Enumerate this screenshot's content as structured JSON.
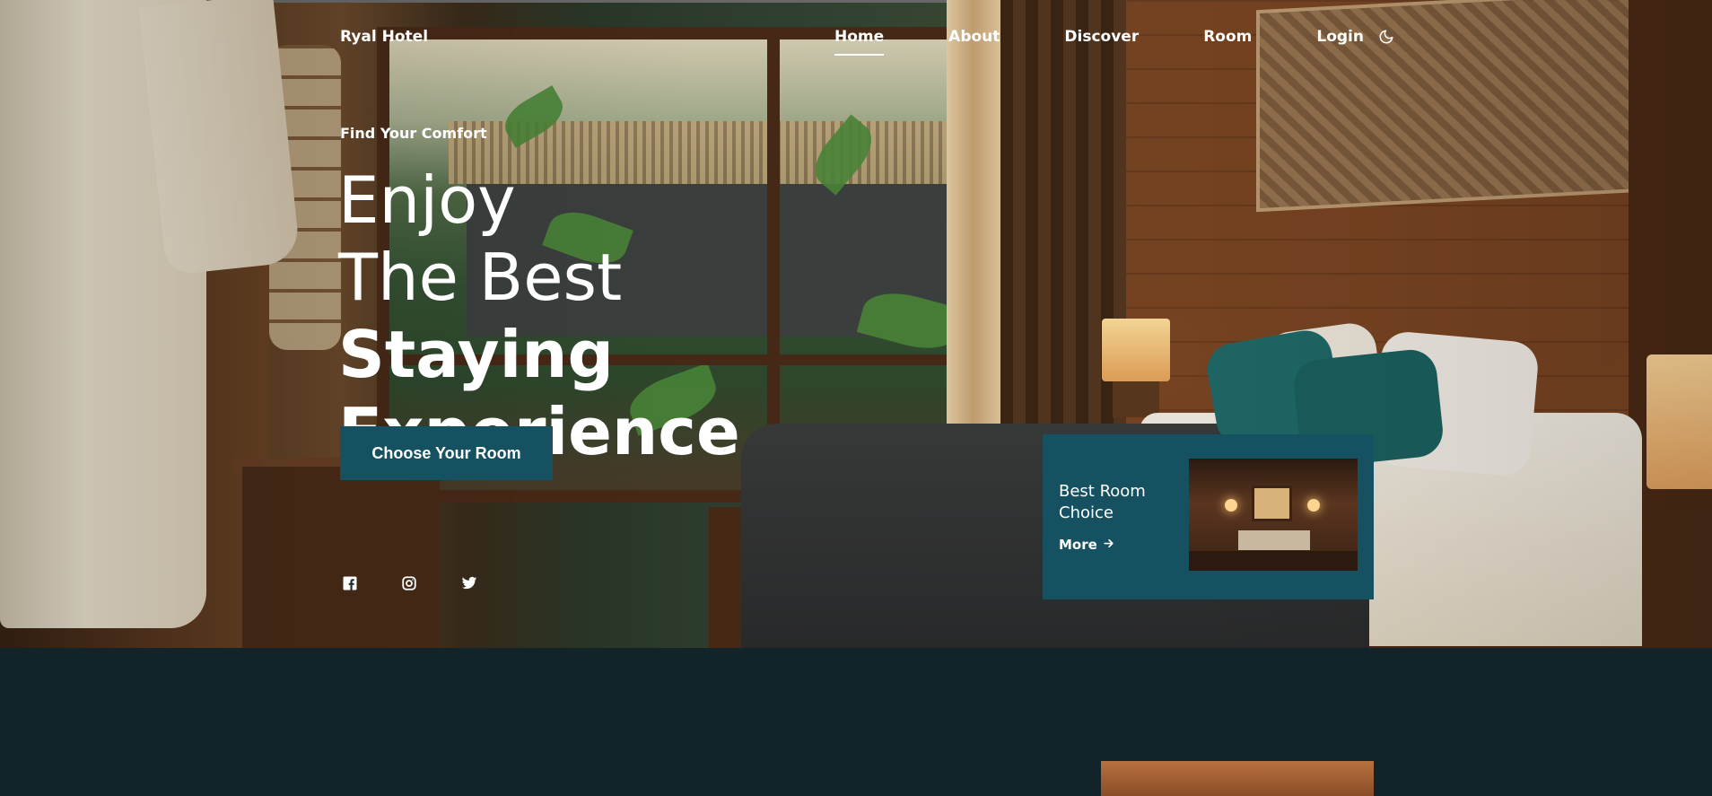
{
  "brand": {
    "name": "Ryal Hotel"
  },
  "nav": {
    "items": [
      {
        "label": "Home",
        "active": true
      },
      {
        "label": "About",
        "active": false
      },
      {
        "label": "Discover",
        "active": false
      },
      {
        "label": "Room",
        "active": false
      },
      {
        "label": "Login",
        "active": false
      }
    ],
    "theme_toggle_icon": "moon-icon"
  },
  "hero": {
    "eyebrow": "Find Your Comfort",
    "headline_line1": "Enjoy",
    "headline_line2_light": "The Best ",
    "headline_line2_bold": "Staying",
    "headline_line3_bold": "Experience",
    "cta_label": "Choose Your Room"
  },
  "socials": [
    {
      "icon": "facebook-icon"
    },
    {
      "icon": "instagram-icon"
    },
    {
      "icon": "twitter-icon"
    }
  ],
  "room_card": {
    "title": "Best Room Choice",
    "more_label": "More",
    "more_icon": "arrow-right-icon"
  },
  "colors": {
    "accent": "#155160",
    "page_bg": "#13232a",
    "text": "#ffffff"
  }
}
